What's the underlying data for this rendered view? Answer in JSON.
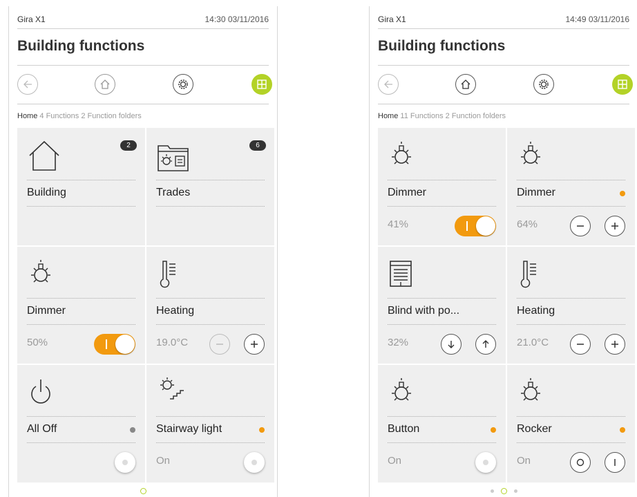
{
  "screens": [
    {
      "status": {
        "app": "Gira X1",
        "time": "14:30  03/11/2016"
      },
      "title": "Building functions",
      "breadcrumb": {
        "home": "Home",
        "rest": " 4  Functions  2  Function folders"
      },
      "tiles": [
        {
          "label": "Building",
          "badge": "2",
          "icon": "house-icon"
        },
        {
          "label": "Trades",
          "badge": "6",
          "icon": "trades-folder-icon"
        },
        {
          "label": "Dimmer",
          "value": "50%",
          "icon": "bulb-icon",
          "control": "toggle"
        },
        {
          "label": "Heating",
          "value": "19.0°C",
          "icon": "thermometer-icon",
          "control": "plusminus-disabled"
        },
        {
          "label": "All Off",
          "icon": "power-icon",
          "status": "gray",
          "control": "push"
        },
        {
          "label": "Stairway light",
          "value": "On",
          "icon": "stairway-light-icon",
          "status": "orange",
          "control": "push"
        }
      ],
      "pager": {
        "count": 1,
        "active": 0
      }
    },
    {
      "status": {
        "app": "Gira X1",
        "time": "14:49  03/11/2016"
      },
      "title": "Building functions",
      "breadcrumb": {
        "home": "Home",
        "rest": " 11  Functions  2  Function folders"
      },
      "tiles": [
        {
          "label": "Dimmer",
          "value": "41%",
          "icon": "bulb-icon",
          "control": "toggle"
        },
        {
          "label": "Dimmer",
          "value": "64%",
          "icon": "bulb-icon",
          "status": "orange",
          "control": "plusminus"
        },
        {
          "label": "Blind with po...",
          "value": "32%",
          "icon": "blind-icon",
          "control": "updown"
        },
        {
          "label": "Heating",
          "value": "21.0°C",
          "icon": "thermometer-icon",
          "control": "plusminus"
        },
        {
          "label": "Button",
          "value": "On",
          "icon": "bulb-icon",
          "status": "orange",
          "control": "push"
        },
        {
          "label": "Rocker",
          "value": "On",
          "icon": "bulb-icon",
          "status": "orange",
          "control": "rocker"
        }
      ],
      "pager": {
        "count": 3,
        "active": 1
      }
    }
  ],
  "colors": {
    "accent": "#b3d227",
    "active": "#f29a0f",
    "tile": "#efefef"
  }
}
